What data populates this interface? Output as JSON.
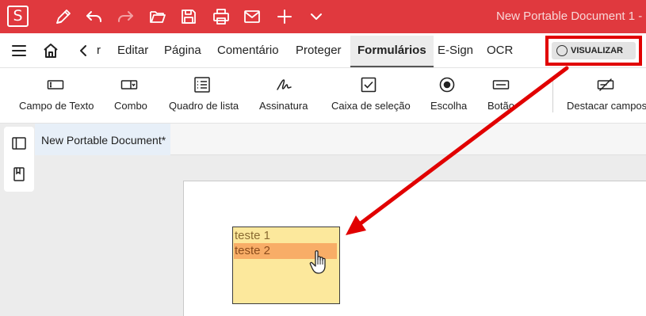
{
  "window": {
    "app_logo": "S",
    "doc_title": "New Portable Document 1  -",
    "quick_icons": [
      "pen-icon",
      "undo-icon",
      "redo-icon",
      "open-folder-icon",
      "save-icon",
      "print-icon",
      "mail-icon",
      "plus-icon",
      "chevron-down-icon"
    ]
  },
  "menubar": {
    "back_truncated": "r",
    "items": [
      "Editar",
      "Página",
      "Comentário",
      "Proteger",
      "Formulários",
      "E-Sign",
      "OCR"
    ],
    "active_index": 4,
    "preview_label": "VISUALIZAR"
  },
  "toolbar": {
    "tools": [
      {
        "label": "Campo de Texto",
        "icon": "text-field-icon"
      },
      {
        "label": "Combo",
        "icon": "combo-box-icon"
      },
      {
        "label": "Quadro de lista",
        "icon": "list-box-icon"
      },
      {
        "label": "Assinatura",
        "icon": "signature-icon"
      },
      {
        "label": "Caixa de seleção",
        "icon": "checkbox-icon"
      },
      {
        "label": "Escolha",
        "icon": "radio-button-icon"
      },
      {
        "label": "Botão",
        "icon": "button-field-icon"
      },
      {
        "label": "Destacar campos",
        "icon": "highlight-fields-icon"
      }
    ]
  },
  "sidebar": {
    "icons": [
      "panel-icon",
      "bookmark-icon"
    ]
  },
  "document": {
    "tab_label": "New Portable Document*",
    "listbox": {
      "options": [
        "teste 1",
        "teste 2"
      ],
      "selected_index": 1
    }
  },
  "colors": {
    "brand_red": "#e0393e",
    "annotation_red": "#e10000",
    "listbox_fill": "#fce89c",
    "listbox_selected": "#f8ad67"
  }
}
